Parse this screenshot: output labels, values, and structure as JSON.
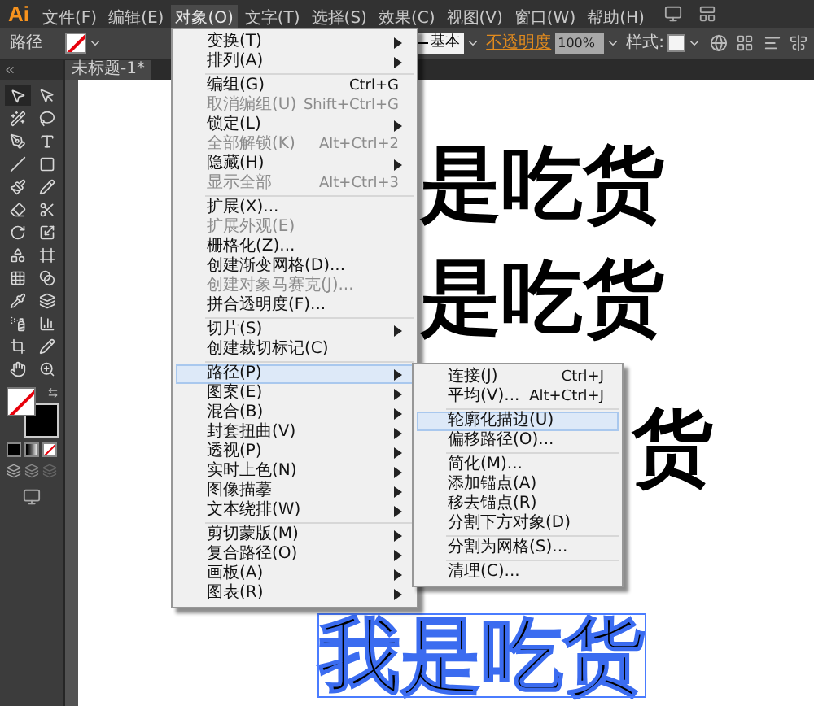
{
  "app_logo": "Ai",
  "menubar": [
    {
      "label": "文件(F)",
      "selected": false
    },
    {
      "label": "编辑(E)",
      "selected": false
    },
    {
      "label": "对象(O)",
      "selected": true
    },
    {
      "label": "文字(T)",
      "selected": false
    },
    {
      "label": "选择(S)",
      "selected": false
    },
    {
      "label": "效果(C)",
      "selected": false
    },
    {
      "label": "视图(V)",
      "selected": false
    },
    {
      "label": "窗口(W)",
      "selected": false
    },
    {
      "label": "帮助(H)",
      "selected": false
    }
  ],
  "control_bar": {
    "object_type": "路径",
    "stroke_style": "基本",
    "opacity_label": "不透明度",
    "opacity_value": "100%",
    "style_label": "样式:"
  },
  "document_tab": {
    "title": "未标题-1*"
  },
  "tools": [
    {
      "selected": true
    },
    {
      "selected": false
    },
    {
      "selected": false
    },
    {
      "selected": false
    },
    {
      "selected": false
    },
    {
      "selected": false
    },
    {
      "selected": false
    },
    {
      "selected": false
    },
    {
      "selected": false
    },
    {
      "selected": false
    },
    {
      "selected": false
    },
    {
      "selected": false
    },
    {
      "selected": false
    },
    {
      "selected": false
    },
    {
      "selected": false
    },
    {
      "selected": false
    },
    {
      "selected": false
    },
    {
      "selected": false
    },
    {
      "selected": false
    },
    {
      "selected": false
    },
    {
      "selected": false
    },
    {
      "selected": false
    },
    {
      "selected": false
    },
    {
      "selected": false
    }
  ],
  "artwork": [
    {
      "text": "是吃货",
      "selected": false
    },
    {
      "text": "是吃货",
      "selected": false
    },
    {
      "text": "货",
      "selected": false
    },
    {
      "text": "我是吃货",
      "selected": true
    }
  ],
  "object_menu": {
    "groups": [
      {
        "items": [
          {
            "label": "变换(T)",
            "disabled": false,
            "submenu": true,
            "selected": false
          },
          {
            "label": "排列(A)",
            "disabled": false,
            "submenu": true,
            "selected": false
          }
        ]
      },
      {
        "items": [
          {
            "label": "编组(G)",
            "shortcut": "Ctrl+G",
            "disabled": false,
            "submenu": false,
            "selected": false
          },
          {
            "label": "取消编组(U)",
            "shortcut": "Shift+Ctrl+G",
            "disabled": true,
            "submenu": false,
            "selected": false
          },
          {
            "label": "锁定(L)",
            "disabled": false,
            "submenu": true,
            "selected": false
          },
          {
            "label": "全部解锁(K)",
            "shortcut": "Alt+Ctrl+2",
            "disabled": true,
            "submenu": false,
            "selected": false
          },
          {
            "label": "隐藏(H)",
            "disabled": false,
            "submenu": true,
            "selected": false
          },
          {
            "label": "显示全部",
            "shortcut": "Alt+Ctrl+3",
            "disabled": true,
            "submenu": false,
            "selected": false
          }
        ]
      },
      {
        "items": [
          {
            "label": "扩展(X)...",
            "disabled": false,
            "submenu": false,
            "selected": false
          },
          {
            "label": "扩展外观(E)",
            "disabled": true,
            "submenu": false,
            "selected": false
          },
          {
            "label": "栅格化(Z)...",
            "disabled": false,
            "submenu": false,
            "selected": false
          },
          {
            "label": "创建渐变网格(D)...",
            "disabled": false,
            "submenu": false,
            "selected": false
          },
          {
            "label": "创建对象马赛克(J)...",
            "disabled": true,
            "submenu": false,
            "selected": false
          },
          {
            "label": "拼合透明度(F)...",
            "disabled": false,
            "submenu": false,
            "selected": false
          }
        ]
      },
      {
        "items": [
          {
            "label": "切片(S)",
            "disabled": false,
            "submenu": true,
            "selected": false
          },
          {
            "label": "创建裁切标记(C)",
            "disabled": false,
            "submenu": false,
            "selected": false
          }
        ]
      },
      {
        "items": [
          {
            "label": "路径(P)",
            "disabled": false,
            "submenu": true,
            "selected": true
          },
          {
            "label": "图案(E)",
            "disabled": false,
            "submenu": true,
            "selected": false
          },
          {
            "label": "混合(B)",
            "disabled": false,
            "submenu": true,
            "selected": false
          },
          {
            "label": "封套扭曲(V)",
            "disabled": false,
            "submenu": true,
            "selected": false
          },
          {
            "label": "透视(P)",
            "disabled": false,
            "submenu": true,
            "selected": false
          },
          {
            "label": "实时上色(N)",
            "disabled": false,
            "submenu": true,
            "selected": false
          },
          {
            "label": "图像描摹",
            "disabled": false,
            "submenu": true,
            "selected": false
          },
          {
            "label": "文本绕排(W)",
            "disabled": false,
            "submenu": true,
            "selected": false
          }
        ]
      },
      {
        "items": [
          {
            "label": "剪切蒙版(M)",
            "disabled": false,
            "submenu": true,
            "selected": false
          },
          {
            "label": "复合路径(O)",
            "disabled": false,
            "submenu": true,
            "selected": false
          },
          {
            "label": "画板(A)",
            "disabled": false,
            "submenu": true,
            "selected": false
          },
          {
            "label": "图表(R)",
            "disabled": false,
            "submenu": true,
            "selected": false
          }
        ]
      }
    ]
  },
  "path_submenu": {
    "groups": [
      {
        "items": [
          {
            "label": "连接(J)",
            "shortcut": "Ctrl+J",
            "disabled": false,
            "selected": false
          },
          {
            "label": "平均(V)...",
            "shortcut": "Alt+Ctrl+J",
            "disabled": false,
            "selected": false
          }
        ]
      },
      {
        "items": [
          {
            "label": "轮廓化描边(U)",
            "disabled": false,
            "selected": true
          },
          {
            "label": "偏移路径(O)...",
            "disabled": false,
            "selected": false
          }
        ]
      },
      {
        "items": [
          {
            "label": "简化(M)...",
            "disabled": false,
            "selected": false
          },
          {
            "label": "添加锚点(A)",
            "disabled": false,
            "selected": false
          },
          {
            "label": "移去锚点(R)",
            "disabled": false,
            "selected": false
          },
          {
            "label": "分割下方对象(D)",
            "disabled": false,
            "selected": false
          }
        ]
      },
      {
        "items": [
          {
            "label": "分割为网格(S)...",
            "disabled": false,
            "selected": false
          }
        ]
      },
      {
        "items": [
          {
            "label": "清理(C)...",
            "disabled": false,
            "selected": false
          }
        ]
      }
    ]
  }
}
